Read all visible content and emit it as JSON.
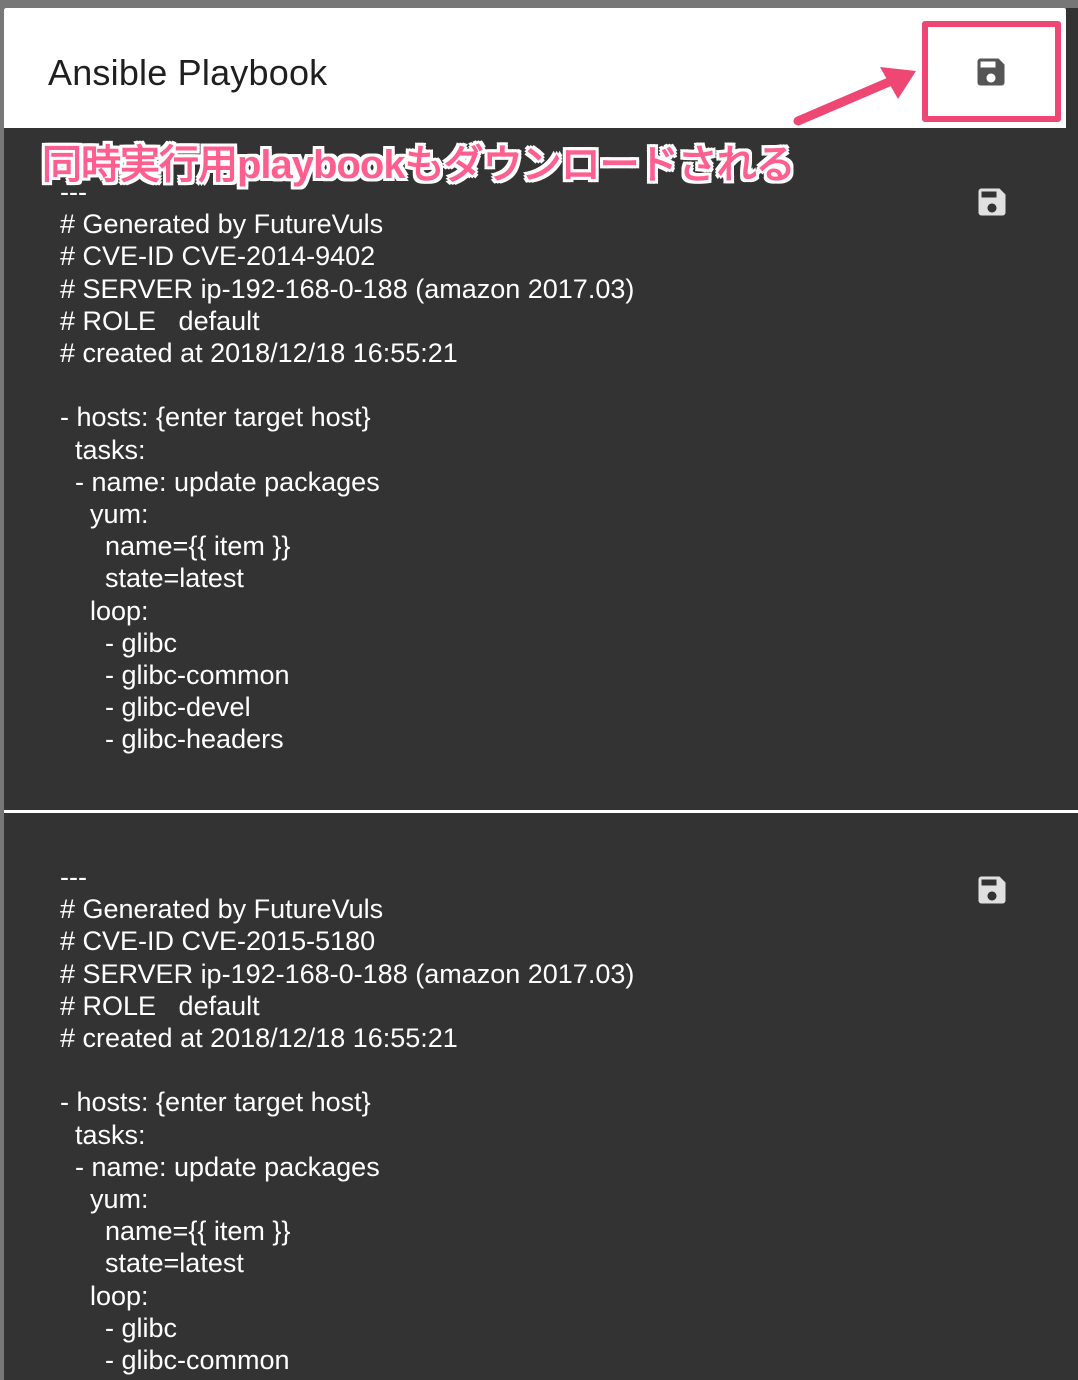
{
  "dialog": {
    "title": "Ansible Playbook"
  },
  "annotation": {
    "text": "同時実行用playbookもダウンロードされる",
    "color": "#ee4774"
  },
  "icons": {
    "save": "floppy-disk-icon"
  },
  "playbooks": [
    {
      "lines": [
        "---",
        "# Generated by FutureVuls",
        "# CVE-ID CVE-2014-9402",
        "# SERVER ip-192-168-0-188 (amazon 2017.03)",
        "# ROLE   default",
        "# created at 2018/12/18 16:55:21",
        "",
        "- hosts: {enter target host}",
        "  tasks:",
        "  - name: update packages",
        "    yum:",
        "      name={{ item }}",
        "      state=latest",
        "    loop:",
        "      - glibc",
        "      - glibc-common",
        "      - glibc-devel",
        "      - glibc-headers"
      ]
    },
    {
      "lines": [
        "---",
        "# Generated by FutureVuls",
        "# CVE-ID CVE-2015-5180",
        "# SERVER ip-192-168-0-188 (amazon 2017.03)",
        "# ROLE   default",
        "# created at 2018/12/18 16:55:21",
        "",
        "- hosts: {enter target host}",
        "  tasks:",
        "  - name: update packages",
        "    yum:",
        "      name={{ item }}",
        "      state=latest",
        "    loop:",
        "      - glibc",
        "      - glibc-common"
      ]
    }
  ],
  "colors": {
    "header_bg": "#ffffff",
    "code_bg": "#333333",
    "icon": "#555555",
    "highlight": "#ee4774"
  }
}
